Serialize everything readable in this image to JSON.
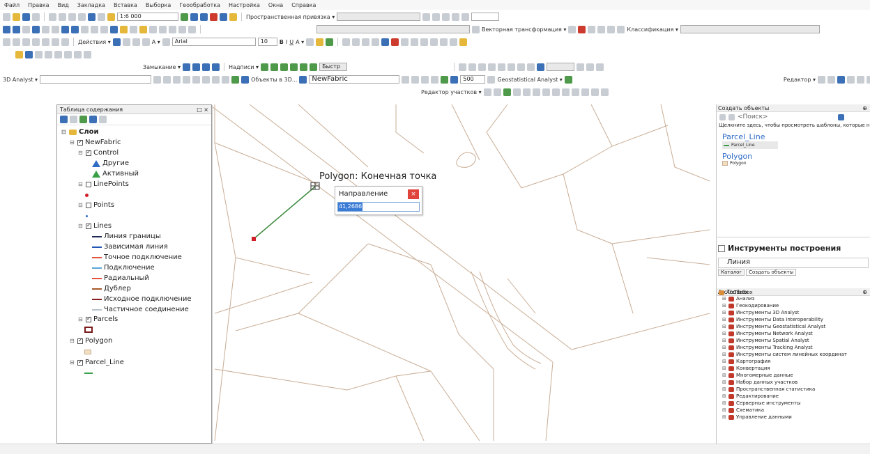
{
  "menu": [
    "Файл",
    "Правка",
    "Вид",
    "Закладка",
    "Вставка",
    "Выборка",
    "Геообработка",
    "Настройка",
    "Окна",
    "Справка"
  ],
  "toolbar": {
    "scale": "1:6 000",
    "snapping": "Пространственная привязка ▾",
    "vector_transform": "Векторная трансформация ▾",
    "classification": "Классификация ▾",
    "actions": "Действия ▾",
    "font": "Arial",
    "font_size": "10",
    "closure": "Замыкание ▾",
    "labels": "Надписи ▾",
    "quick": "Быстр",
    "analyst3d": "3D Analyst ▾",
    "objects3d": "Объекты в 3D...",
    "layer": "NewFabric",
    "number": "500",
    "geostat": "Geostatistical Analyst ▾",
    "editor": "Редактор ▾",
    "parcel_editor": "Редактор участков ▾"
  },
  "toc": {
    "title": "Таблица содержания",
    "controls": "□ ×",
    "root": "Слои",
    "layer_newfabric": "NewFabric",
    "layer_control": "Control",
    "control_items": [
      "Другие",
      "Активный"
    ],
    "layer_linepoints": "LinePoints",
    "layer_points": "Points",
    "layer_lines": "Lines",
    "line_items": [
      {
        "label": "Линия границы",
        "color": "#1f2a55"
      },
      {
        "label": "Зависимая линия",
        "color": "#2257b5"
      },
      {
        "label": "Точное подключение",
        "color": "#e2533d"
      },
      {
        "label": "Подключение",
        "color": "#5aa6d8"
      },
      {
        "label": "Радиальный",
        "color": "#e2533d"
      },
      {
        "label": "Дублер",
        "color": "#a5582a"
      },
      {
        "label": "Исходное подключение",
        "color": "#8a1f1f"
      },
      {
        "label": "Частичное соединение",
        "color": "#b9c4cc"
      }
    ],
    "layer_parcels": "Parcels",
    "layer_polygon": "Polygon",
    "layer_parcel_line": "Parcel_Line"
  },
  "map": {
    "snap_tip": "Polygon: Конечная точка"
  },
  "dialog": {
    "title": "Направление",
    "close": "×",
    "value": "41,2686"
  },
  "create_features": {
    "title": "Создать объекты",
    "search_placeholder": "<Поиск>",
    "hint": "Щелкните здесь, чтобы просмотреть шаблоны, которые не",
    "group1": "Parcel_Line",
    "item1": "Parcel_Line",
    "group2": "Polygon",
    "item2": "Polygon"
  },
  "construction": {
    "title": "Инструменты построения",
    "item": "Линия",
    "tab_catalog": "Каталог",
    "tab_create": "Создать объекты"
  },
  "arctoolbox": {
    "title": "ArcToolbox",
    "root": "ArcToolbox",
    "items": [
      "Анализ",
      "Геокодирование",
      "Инструменты 3D Analyst",
      "Инструменты Data Interoperability",
      "Инструменты Geostatistical Analyst",
      "Инструменты Network Analyst",
      "Инструменты Spatial Analyst",
      "Инструменты Tracking Analyst",
      "Инструменты систем линейных координат",
      "Картография",
      "Конвертация",
      "Многомерные данные",
      "Набор данных участков",
      "Пространственная статистика",
      "Редактирование",
      "Серверные инструменты",
      "Схематика",
      "Управление данными"
    ]
  }
}
